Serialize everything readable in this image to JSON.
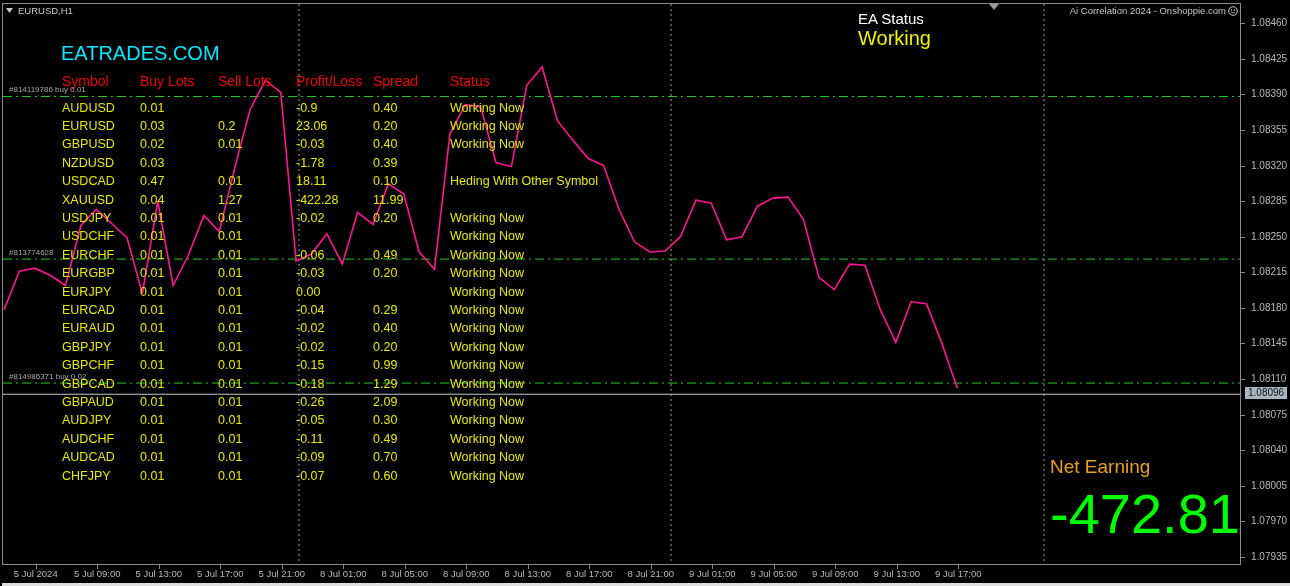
{
  "chart_window": {
    "symbol": "EURUSD,H1",
    "indicator": "Ai Correlation 2024 - Onshoppie.com",
    "chart_data": {
      "type": "line",
      "categories": [
        null,
        null,
        "5 Jul 2024",
        null,
        null,
        null,
        "5 Jul 09:00",
        null,
        null,
        null,
        "5 Jul 13:00",
        null,
        null,
        null,
        "5 Jul 17:00",
        null,
        null,
        null,
        "5 Jul 21:00",
        null,
        null,
        null,
        "8 Jul 01:00",
        null,
        null,
        null,
        "8 Jul 05:00",
        null,
        null,
        null,
        "8 Jul 09:00",
        null,
        null,
        null,
        "8 Jul 13:00",
        null,
        null,
        null,
        "8 Jul 17:00",
        null,
        null,
        null,
        "8 Jul 21:00",
        null,
        null,
        null,
        "9 Jul 01:00",
        null,
        null,
        null,
        "9 Jul 05:00",
        null,
        null,
        null,
        "9 Jul 09:00",
        null,
        null,
        null,
        "9 Jul 13:00",
        null,
        null,
        null,
        "9 Jul 17:00",
        null,
        null,
        null,
        null,
        null,
        null,
        null,
        null,
        null,
        null,
        null,
        null,
        null,
        null,
        null,
        null,
        null,
        null
      ],
      "series": [
        {
          "color": "#ff1493",
          "values": [
            1.08179,
            1.08217,
            1.0822,
            1.08213,
            1.08203,
            1.08262,
            1.08278,
            1.08264,
            1.0825,
            1.08195,
            1.08286,
            1.08203,
            1.08233,
            1.08272,
            1.08256,
            1.08318,
            1.08376,
            1.08405,
            1.08393,
            1.08227,
            1.08234,
            1.08254,
            1.08224,
            1.08275,
            1.08263,
            1.08303,
            1.08293,
            1.08236,
            1.08219,
            1.08352,
            1.08381,
            1.08379,
            1.08324,
            1.0832,
            1.084,
            1.08418,
            1.08365,
            1.08346,
            1.08328,
            1.08321,
            1.08278,
            1.08246,
            1.08236,
            1.08237,
            1.08251,
            1.08287,
            1.08284,
            1.08248,
            1.08251,
            1.08281,
            1.08289,
            1.0829,
            1.08268,
            1.08211,
            1.08199,
            1.08224,
            1.08223,
            1.08179,
            1.08147,
            1.08187,
            1.08185,
            1.08146,
            1.08102,
            null,
            null,
            null,
            null,
            null,
            null,
            null,
            null,
            null,
            null,
            null,
            null,
            null,
            null,
            null,
            null,
            null,
            null
          ]
        }
      ],
      "ylim": [
        1.07927,
        1.0848
      ],
      "yticks": [
        {
          "value": 1.0846,
          "label": "1.08460"
        },
        {
          "value": 1.08425,
          "label": "1.08425"
        },
        {
          "value": 1.0839,
          "label": "1.08390"
        },
        {
          "value": 1.08355,
          "label": "1.08355"
        },
        {
          "value": 1.0832,
          "label": "1.08320"
        },
        {
          "value": 1.08285,
          "label": "1.08285"
        },
        {
          "value": 1.0825,
          "label": "1.08250"
        },
        {
          "value": 1.08215,
          "label": "1.08215"
        },
        {
          "value": 1.0818,
          "label": "1.08180"
        },
        {
          "value": 1.08145,
          "label": "1.08145"
        },
        {
          "value": 1.0811,
          "label": "1.08110"
        },
        {
          "value": 1.08075,
          "label": "1.08075"
        },
        {
          "value": 1.0804,
          "label": "1.08040"
        },
        {
          "value": 1.08005,
          "label": "1.08005"
        },
        {
          "value": 1.0797,
          "label": "1.07970"
        },
        {
          "value": 1.07935,
          "label": "1.07935"
        }
      ],
      "ref_lines": [
        {
          "axis": "y",
          "value": 1.08389
        },
        {
          "axis": "y",
          "value": 1.08229
        },
        {
          "axis": "y",
          "value": 1.08107
        },
        {
          "axis": "y",
          "value": 1.08096,
          "label": "1.08096"
        }
      ]
    },
    "orders": [
      {
        "label": "#814119786 buy 0.01"
      },
      {
        "label": "#813774628"
      },
      {
        "label": "#814986371 buy 0.02"
      }
    ]
  },
  "brand": "EATRADES.COM",
  "table": {
    "columns": [
      "Symbol",
      "Buy Lots",
      "Sell Lots",
      "Profit/Loss",
      "Spread",
      "Status"
    ],
    "rows": [
      {
        "symbol": "AUDUSD",
        "buy_lots": "0.01",
        "profit_loss": "-0.9",
        "spread": "0.40",
        "status": "Working Now"
      },
      {
        "symbol": "EURUSD",
        "buy_lots": "0.03",
        "sell_lots": "0.2",
        "profit_loss": "23.06",
        "spread": "0.20",
        "status": "Working Now"
      },
      {
        "symbol": "GBPUSD",
        "buy_lots": "0.02",
        "sell_lots": "0.01",
        "profit_loss": "-0.03",
        "spread": "0.40",
        "status": "Working Now"
      },
      {
        "symbol": "NZDUSD",
        "buy_lots": "0.03",
        "profit_loss": "-1.78",
        "spread": "0.39"
      },
      {
        "symbol": "USDCAD",
        "buy_lots": "0.47",
        "sell_lots": "0.01",
        "profit_loss": "18.11",
        "spread": "0.10",
        "status": "Heding With Other Symbol"
      },
      {
        "symbol": "XAUUSD",
        "buy_lots": "0.04",
        "sell_lots": "1.27",
        "profit_loss": "-422.28",
        "spread": "11.99"
      },
      {
        "symbol": "USDJPY",
        "buy_lots": "0.01",
        "sell_lots": "0.01",
        "profit_loss": "-0.02",
        "spread": "0.20",
        "status": "Working Now"
      },
      {
        "symbol": "USDCHF",
        "buy_lots": "0.01",
        "sell_lots": "0.01",
        "status": "Working Now"
      },
      {
        "symbol": "EURCHF",
        "buy_lots": "0.01",
        "sell_lots": "0.01",
        "profit_loss": "-0.06",
        "spread": "0.49",
        "status": "Working Now"
      },
      {
        "symbol": "EURGBP",
        "buy_lots": "0.01",
        "sell_lots": "0.01",
        "profit_loss": "-0.03",
        "spread": "0.20",
        "status": "Working Now"
      },
      {
        "symbol": "EURJPY",
        "buy_lots": "0.01",
        "sell_lots": "0.01",
        "profit_loss": "0.00",
        "status": "Working Now"
      },
      {
        "symbol": "EURCAD",
        "buy_lots": "0.01",
        "sell_lots": "0.01",
        "profit_loss": "-0.04",
        "spread": "0.29",
        "status": "Working Now"
      },
      {
        "symbol": "EURAUD",
        "buy_lots": "0.01",
        "sell_lots": "0.01",
        "profit_loss": "-0.02",
        "spread": "0.40",
        "status": "Working Now"
      },
      {
        "symbol": "GBPJPY",
        "buy_lots": "0.01",
        "sell_lots": "0.01",
        "profit_loss": "-0.02",
        "spread": "0.20",
        "status": "Working Now"
      },
      {
        "symbol": "GBPCHF",
        "buy_lots": "0.01",
        "sell_lots": "0.01",
        "profit_loss": "-0.15",
        "spread": "0.99",
        "status": "Working Now"
      },
      {
        "symbol": "GBPCAD",
        "buy_lots": "0.01",
        "sell_lots": "0.01",
        "profit_loss": "-0.18",
        "spread": "1.29",
        "status": "Working Now"
      },
      {
        "symbol": "GBPAUD",
        "buy_lots": "0.01",
        "sell_lots": "0.01",
        "profit_loss": "-0.26",
        "spread": "2.09",
        "status": "Working Now"
      },
      {
        "symbol": "AUDJPY",
        "buy_lots": "0.01",
        "sell_lots": "0.01",
        "profit_loss": "-0.05",
        "spread": "0.30",
        "status": "Working Now"
      },
      {
        "symbol": "AUDCHF",
        "buy_lots": "0.01",
        "sell_lots": "0.01",
        "profit_loss": "-0.11",
        "spread": "0.49",
        "status": "Working Now"
      },
      {
        "symbol": "AUDCAD",
        "buy_lots": "0.01",
        "sell_lots": "0.01",
        "profit_loss": "-0.09",
        "spread": "0.70",
        "status": "Working Now"
      },
      {
        "symbol": "CHFJPY",
        "buy_lots": "0.01",
        "sell_lots": "0.01",
        "profit_loss": "-0.07",
        "spread": "0.60",
        "status": "Working Now"
      }
    ]
  },
  "ea_status": {
    "label": "EA Status",
    "value": "Working"
  },
  "net_earning": {
    "label": "Net Earning",
    "value": "-472.81"
  }
}
